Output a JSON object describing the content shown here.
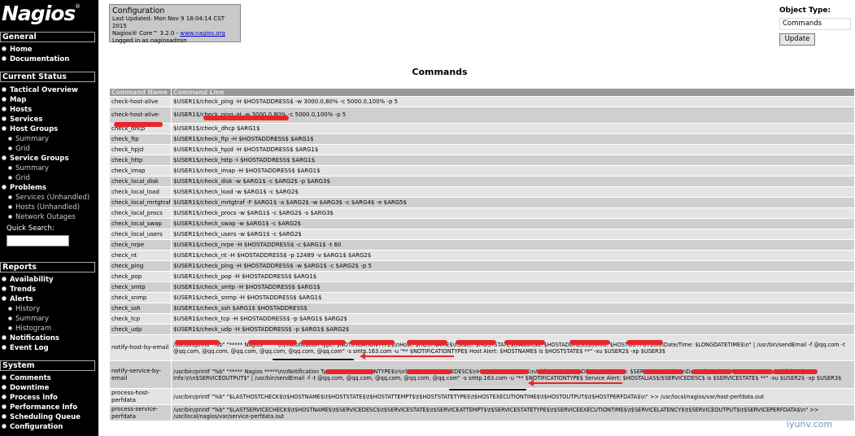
{
  "sidebar": {
    "logo": "Nagios",
    "logo_mark": "®",
    "general": {
      "title": "General",
      "items": [
        "Home",
        "Documentation"
      ]
    },
    "current_status": {
      "title": "Current Status",
      "items": [
        "Tactical Overview",
        "Map",
        "Hosts",
        "Services",
        "Host Groups",
        "Summary",
        "Grid",
        "Service Groups",
        "Summary",
        "Grid",
        "Problems",
        "Services (Unhandled)",
        "Hosts (Unhandled)",
        "Network Outages"
      ]
    },
    "quick_search_label": "Quick Search:",
    "reports": {
      "title": "Reports",
      "items": [
        "Availability",
        "Trends",
        "Alerts",
        "History",
        "Summary",
        "Histogram",
        "Notifications",
        "Event Log"
      ]
    },
    "system": {
      "title": "System",
      "items": [
        "Comments",
        "Downtime",
        "Process Info",
        "Performance Info",
        "Scheduling Queue",
        "Configuration"
      ]
    }
  },
  "info": {
    "title": "Configuration",
    "updated": "Last Updated: Mon Nov 9 18:04:14 CST 2015",
    "core_prefix": "Nagios® Core™ 3.2.0 - ",
    "core_link": "www.nagios.org",
    "logged_prefix": "Logged in as ",
    "user": "nagiosadmin"
  },
  "object_type": {
    "label": "Object Type:",
    "selected": "Commands",
    "button": "Update"
  },
  "page_title": "Commands",
  "table": {
    "headers": [
      "Command Name",
      "Command Line"
    ],
    "rows": [
      [
        "check-host-alive",
        "$USER1$/check_ping -H $HOSTADDRESS$ -w 3000.0,80% -c 5000.0,100% -p 5"
      ],
      [
        "check-host-alive-",
        "$USER1$/check_ping -H               -w 3000.0,80% -c 5000.0,100% -p 5"
      ],
      [
        "check_dhcp",
        "$USER1$/check_dhcp $ARG1$"
      ],
      [
        "check_ftp",
        "$USER1$/check_ftp -H $HOSTADDRESS$ $ARG1$"
      ],
      [
        "check_hpjd",
        "$USER1$/check_hpjd -H $HOSTADDRESS$ $ARG1$"
      ],
      [
        "check_http",
        "$USER1$/check_http -I $HOSTADDRESS$ $ARG1$"
      ],
      [
        "check_imap",
        "$USER1$/check_imap -H $HOSTADDRESS$ $ARG1$"
      ],
      [
        "check_local_disk",
        "$USER1$/check_disk -w $ARG1$ -c $ARG2$ -p $ARG3$"
      ],
      [
        "check_local_load",
        "$USER1$/check_load -w $ARG1$ -c $ARG2$"
      ],
      [
        "check_local_mrtgtraf",
        "$USER1$/check_mrtgtraf -F $ARG1$ -a $ARG2$ -w $ARG3$ -c $ARG4$ -e $ARG5$"
      ],
      [
        "check_local_procs",
        "$USER1$/check_procs -w $ARG1$ -c $ARG2$ -s $ARG3$"
      ],
      [
        "check_local_swap",
        "$USER1$/check_swap -w $ARG1$ -c $ARG2$"
      ],
      [
        "check_local_users",
        "$USER1$/check_users -w $ARG1$ -c $ARG2$"
      ],
      [
        "check_nrpe",
        "$USER1$/check_nrpe -H $HOSTADDRESS$ -c $ARG1$ -t 60"
      ],
      [
        "check_nt",
        "$USER1$/check_nt -H $HOSTADDRESS$ -p 12489 -v $ARG1$ $ARG2$"
      ],
      [
        "check_ping",
        "$USER1$/check_ping -H $HOSTADDRESS$ -w $ARG1$ -c $ARG2$ -p 5"
      ],
      [
        "check_pop",
        "$USER1$/check_pop -H $HOSTADDRESS$ $ARG1$"
      ],
      [
        "check_smtp",
        "$USER1$/check_smtp -H $HOSTADDRESS$ $ARG1$"
      ],
      [
        "check_snmp",
        "$USER1$/check_snmp -H $HOSTADDRESS$ $ARG1$"
      ],
      [
        "check_ssh",
        "$USER1$/check_ssh $ARG1$ $HOSTADDRESS$"
      ],
      [
        "check_tcp",
        "$USER1$/check_tcp -H $HOSTADDRESS$ -p $ARG1$ $ARG2$"
      ],
      [
        "check_udp",
        "$USER1$/check_udp -H $HOSTADDRESS$ -p $ARG1$ $ARG2$"
      ],
      [
        "notify-host-by-email",
        "/usr/bin/printf \"%b\" \"***** Nagios *****\\n\\nNotification Type: $NOTIFICATIONTYPE$\\nHost: $HOSTNAME$\\nState: $HOSTSTATE$\\nAddress: $HOSTADDRESS$\\nInfo: $HOSTOUTPUT$\\n\\nDate/Time: $LONGDATETIME$\\n\" | /usr/bin/sendEmail -f                  @qq.com -t                @qq.com,               @qq.com,               @qq.com,               @qq.com,               @qq.com,               @qq.com\" -s smtp.163.com -u \"** $NOTIFICATIONTYPE$ Host Alert: $HOSTNAME$ is $HOSTSTATE$ **\" -xu $USER2$ -xp $USER3$"
      ],
      [
        "notify-service-by-email",
        "/usr/bin/printf \"%b\" \"***** Nagios *****\\n\\nNotification Type: $NOTIFICATIONTYPE$\\n\\nService: $SERVICEDESC$\\nHost: $HOSTALIAS$\\nAddress: $HOSTADDRESS$\\nState: $SERVICESTATE$\\n\\nDate/Time: $LONGDATETIME$\\n\\nAdditional Info:\\n\\n$SERVICEOUTPUT$\" | /usr/bin/sendEmail -f                  -t                @qq.com,               @qq.com,               @qq.com,               @qq.com,               @qq.com\" -s smtp.163.com -u \"** $NOTIFICATIONTYPE$ Service Alert: $HOSTALIAS$/$SERVICEDESC$ is $SERVICESTATE$ **\" -xu $USER2$ -xp $USER3$"
      ],
      [
        "process-host-perfdata",
        "/usr/bin/printf \"%b\" \"$LASTHOSTCHECK$\\t$HOSTNAME$\\t$HOSTSTATE$\\t$HOSTATTEMPT$\\t$HOSTSTATETYPE$\\t$HOSTEXECUTIONTIME$\\t$HOSTOUTPUT$\\t$HOSTPERFDATA$\\n\" >> /usr/local/nagios/var/host-perfdata.out"
      ],
      [
        "process-service-perfdata",
        "/usr/bin/printf \"%b\" \"$LASTSERVICECHECK$\\t$HOSTNAME$\\t$SERVICEDESC$\\t$SERVICESTATE$\\t$SERVICEATTEMPT$\\t$SERVICESTATETYPE$\\t$SERVICEEXECUTIONTIME$\\t$SERVICELATENCY$\\t$SERVICEOUTPUT$\\t$SERVICEPERFDATA$\\n\" >> /usr/local/nagios/var/service-perfdata.out"
      ]
    ]
  },
  "watermark": "iyunv.com"
}
